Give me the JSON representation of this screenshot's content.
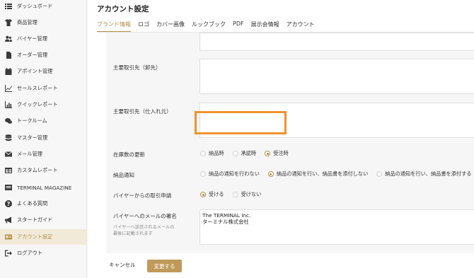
{
  "sidebar": {
    "items": [
      {
        "icon": "grid-icon",
        "label": "ダッシュボード"
      },
      {
        "icon": "tshirt-icon",
        "label": "商品管理"
      },
      {
        "icon": "users-icon",
        "label": "バイヤー管理"
      },
      {
        "icon": "file-icon",
        "label": "オーダー管理"
      },
      {
        "icon": "calendar-icon",
        "label": "アポイント管理"
      },
      {
        "icon": "line-chart-icon",
        "label": "セールスレポート"
      },
      {
        "icon": "bar-chart-icon",
        "label": "クイックレポート"
      },
      {
        "icon": "chat-icon",
        "label": "トークルーム"
      },
      {
        "icon": "database-icon",
        "label": "マスター管理"
      },
      {
        "icon": "mail-icon",
        "label": "メール管理"
      },
      {
        "icon": "table-icon",
        "label": "カスタムレポート"
      },
      {
        "icon": "magazine-icon",
        "label": "TERMINAL MAGAZINE"
      },
      {
        "icon": "question-icon",
        "label": "よくある質問"
      },
      {
        "icon": "megaphone-icon",
        "label": "スタートガイド"
      },
      {
        "icon": "id-card-icon",
        "label": "アカウント設定"
      },
      {
        "icon": "logout-icon",
        "label": "ログアウト"
      }
    ],
    "active_index": 14,
    "accent_color": "#b48f4c"
  },
  "main": {
    "title": "アカウント設定",
    "tabs": [
      "ブランド情報",
      "ロゴ",
      "カバー画像",
      "ルックブック",
      "PDF",
      "展示会情報",
      "アカウント"
    ],
    "active_tab": 0
  },
  "form": {
    "wholesale_label": "主要取引先（卸先）",
    "supplier_label": "主要取引先（仕入れ元）",
    "stock_update": {
      "label": "在庫数の更新",
      "options": [
        "納品時",
        "承認時",
        "受注時"
      ],
      "selected": 2
    },
    "delivery_notice": {
      "label": "納品通知",
      "options": [
        "納品の通知を行わない",
        "納品の通知を行い、納品書を添付しない",
        "納品の通知を行い、納品書を添付する"
      ],
      "selected": 1
    },
    "buyer_request": {
      "label": "バイヤーからの取引申請",
      "options": [
        "受ける",
        "受けない"
      ],
      "selected": 0
    },
    "signature": {
      "label": "バイヤーへのメールの署名",
      "sub_line1": "バイヤーへ送信されるメールの",
      "sub_line2": "最後に記載されます",
      "line1": "The TERMINAL Inc.",
      "line2": "ターミナル株式会社"
    }
  },
  "actions": {
    "cancel": "キャンセル",
    "save": "変更する"
  },
  "colors": {
    "highlight": "#f0922e",
    "primary_button": "#c09a5a"
  }
}
